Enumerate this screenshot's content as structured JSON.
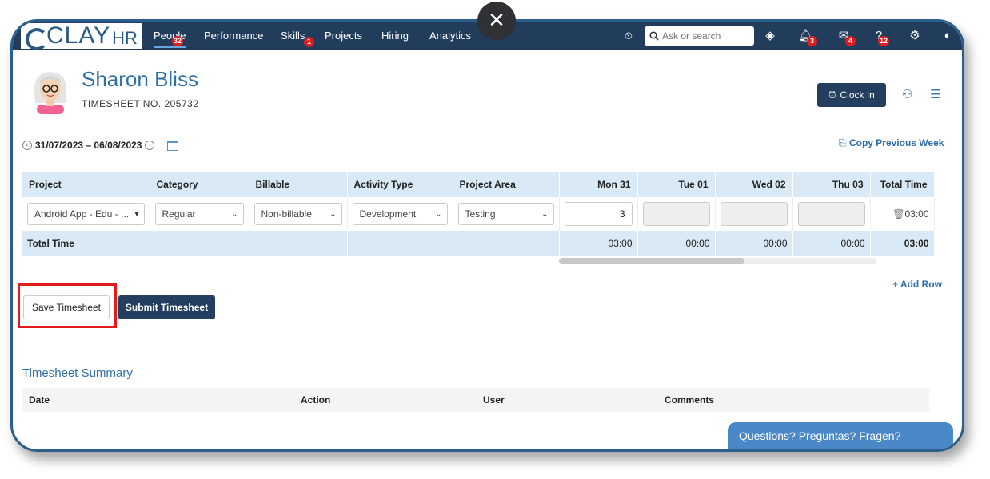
{
  "topbar": {
    "logo_main": "CLAY",
    "logo_suffix": "HR",
    "nav": [
      {
        "label": "People",
        "badge": "32"
      },
      {
        "label": "Performance"
      },
      {
        "label": "Skills",
        "badge": "1"
      },
      {
        "label": "Projects"
      },
      {
        "label": "Hiring"
      },
      {
        "label": "Analytics"
      }
    ],
    "search_placeholder": "Ask or search",
    "notifications_badge": "3",
    "mail_badge": "4",
    "help_badge": "12"
  },
  "header": {
    "name": "Sharon Bliss",
    "timesheet_no": "TIMESHEET NO. 205732",
    "clock_in_label": "Clock In"
  },
  "week": {
    "range": "31/07/2023 – 06/08/2023",
    "copy_previous_label": "Copy Previous Week"
  },
  "table": {
    "columns": [
      "Project",
      "Category",
      "Billable",
      "Activity Type",
      "Project Area",
      "Mon 31",
      "Tue 01",
      "Wed 02",
      "Thu 03",
      "Total Time"
    ],
    "row": {
      "project": "Android App - Edu - ...",
      "category": "Regular",
      "billable": "Non-billable",
      "activity_type": "Development",
      "project_area": "Testing",
      "mon": "3",
      "total": "03:00"
    },
    "totals": {
      "label": "Total Time",
      "mon": "03:00",
      "tue": "00:00",
      "wed": "00:00",
      "thu": "00:00",
      "total": "03:00"
    }
  },
  "actions": {
    "add_row_label": "Add Row",
    "save_label": "Save Timesheet",
    "submit_label": "Submit Timesheet"
  },
  "summary": {
    "title": "Timesheet Summary",
    "columns": [
      "Date",
      "Action",
      "User",
      "Comments"
    ]
  },
  "chat": {
    "label": "Questions? Preguntas? Fragen?"
  },
  "colors": {
    "topbar": "#223c5c",
    "primary_button": "#233e5e",
    "link": "#2f6fa8",
    "table_header": "#d9eaf6",
    "highlight": "#e21b1b",
    "badge": "#e11d1d"
  }
}
